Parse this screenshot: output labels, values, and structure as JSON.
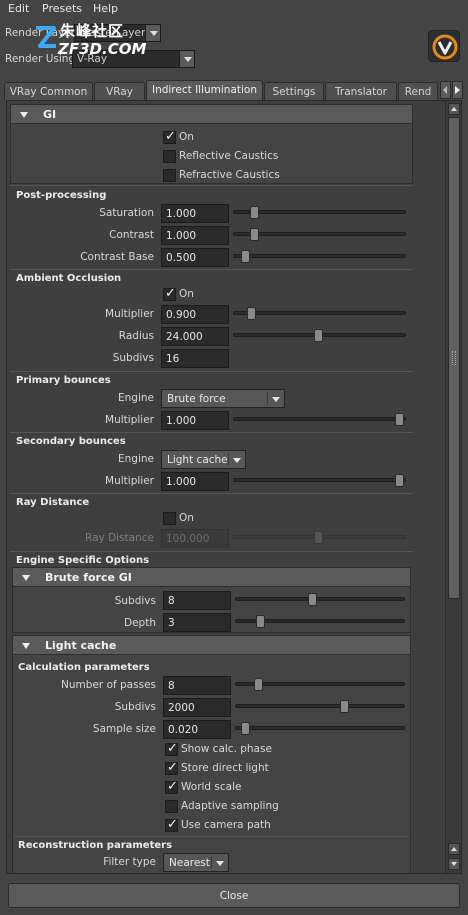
{
  "menu": [
    "Edit",
    "Presets",
    "Help"
  ],
  "render_layer": {
    "label": "Render Layer",
    "value": "masterLayer"
  },
  "render_using": {
    "label": "Render Using",
    "value": "V-Ray"
  },
  "watermark": {
    "cn": "朱峰社区",
    "en": "ZF3D.COM"
  },
  "tabs": [
    "VRay Common",
    "VRay",
    "Indirect Illumination",
    "Settings",
    "Translator",
    "Rend"
  ],
  "gi": {
    "header": "GI",
    "on": "On",
    "reflective_caustics": "Reflective Caustics",
    "refractive_caustics": "Refractive Caustics"
  },
  "post_processing": {
    "title": "Post-processing",
    "saturation_label": "Saturation",
    "saturation": "1.000",
    "contrast_label": "Contrast",
    "contrast": "1.000",
    "contrast_base_label": "Contrast Base",
    "contrast_base": "0.500"
  },
  "ambient_occlusion": {
    "title": "Ambient Occlusion",
    "on": "On",
    "multiplier_label": "Multiplier",
    "multiplier": "0.900",
    "radius_label": "Radius",
    "radius": "24.000",
    "subdivs_label": "Subdivs",
    "subdivs": "16"
  },
  "primary_bounces": {
    "title": "Primary bounces",
    "engine_label": "Engine",
    "engine": "Brute force",
    "multiplier_label": "Multiplier",
    "multiplier": "1.000"
  },
  "secondary_bounces": {
    "title": "Secondary bounces",
    "engine_label": "Engine",
    "engine": "Light cache",
    "multiplier_label": "Multiplier",
    "multiplier": "1.000"
  },
  "ray_distance": {
    "title": "Ray Distance",
    "on": "On",
    "label": "Ray Distance",
    "value": "100.000"
  },
  "engine_specific": {
    "title": "Engine Specific Options"
  },
  "brute_force": {
    "header": "Brute force GI",
    "subdivs_label": "Subdivs",
    "subdivs": "8",
    "depth_label": "Depth",
    "depth": "3"
  },
  "light_cache": {
    "header": "Light cache",
    "calc_title": "Calculation parameters",
    "passes_label": "Number of passes",
    "passes": "8",
    "subdivs_label": "Subdivs",
    "subdivs": "2000",
    "sample_size_label": "Sample size",
    "sample_size": "0.020",
    "show_calc_phase": "Show calc. phase",
    "store_direct_light": "Store direct light",
    "world_scale": "World scale",
    "adaptive_sampling": "Adaptive sampling",
    "use_camera_path": "Use camera path",
    "recon_title": "Reconstruction parameters",
    "filter_type_label": "Filter type",
    "filter_type": "Nearest"
  },
  "close_label": "Close"
}
